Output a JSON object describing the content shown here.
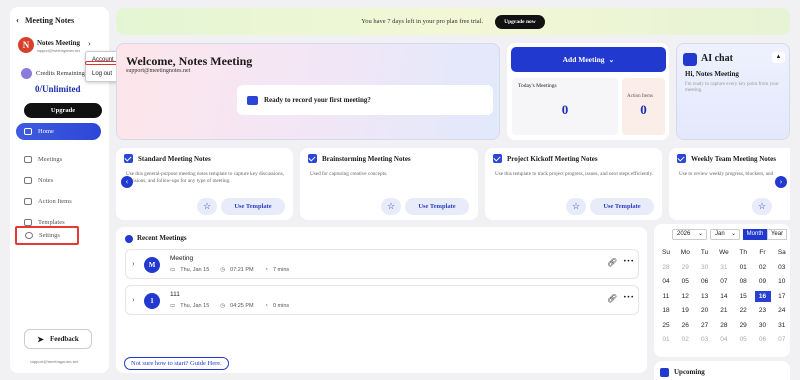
{
  "sidebar": {
    "app_title": "Meeting Notes",
    "back_icon": "chevron-left-icon",
    "user_name": "Notes Meeting",
    "user_email": "support@meetingnotes.net",
    "avatar_letter": "N",
    "credits_label": "Credits Remaining",
    "credits_value": "0/Unlimited",
    "upgrade_label": "Upgrade",
    "nav": [
      {
        "label": "Home",
        "icon": "home-icon"
      },
      {
        "label": "Meetings",
        "icon": "calendar-icon"
      },
      {
        "label": "Notes",
        "icon": "notes-icon"
      },
      {
        "label": "Action Items",
        "icon": "list-icon"
      },
      {
        "label": "Templates",
        "icon": "template-icon"
      },
      {
        "label": "Settings",
        "icon": "gear-icon"
      }
    ],
    "feedback_label": "Feedback",
    "footer_email": "support@meetingnotes.net"
  },
  "account_menu": {
    "account": "Account",
    "logout": "Log out"
  },
  "banner": {
    "text": "You have 7 days left in your pro plan free trial.",
    "button": "Upgrade now"
  },
  "welcome": {
    "title": "Welcome, Notes Meeting",
    "email": "support@meetingnotes.net",
    "cta": "Ready to record your first meeting?"
  },
  "stats": {
    "add_meeting": "Add Meeting",
    "today_label": "Today's Meetings",
    "today_value": "0",
    "action_label": "Action Items",
    "action_value": "0"
  },
  "ai_chat": {
    "title": "AI chat",
    "greeting": "Hi, Notes Meeting",
    "desc": "I'm ready to capture every key point from your meeting."
  },
  "templates": [
    {
      "title": "Standard Meeting Notes",
      "desc": "Use this general-purpose meeting notes template to capture key discussions, decisions, and follow-ups for any type of meeting.",
      "button": "Use Template"
    },
    {
      "title": "Brainstorming Meeting Notes",
      "desc": "Used for capturing creative concepts.",
      "button": "Use Template"
    },
    {
      "title": "Project Kickoff Meeting Notes",
      "desc": "Use this template to track project progress, issues, and next steps efficiently.",
      "button": "Use Template"
    },
    {
      "title": "Weekly Team Meeting Notes",
      "desc": "Use to review weekly progress, blockers, and",
      "button": "Use Template"
    }
  ],
  "recent": {
    "title": "Recent Meetings",
    "items": [
      {
        "letter": "M",
        "name": "Meeting",
        "date": "Thu, Jan 15",
        "time": "07:21 PM",
        "duration": "7 mins"
      },
      {
        "letter": "1",
        "name": "111",
        "date": "Thu, Jan 15",
        "time": "04:25 PM",
        "duration": "0 mins"
      }
    ],
    "guide": "Not sure how to start? Guide Here."
  },
  "calendar": {
    "year": "2026",
    "month": "Jan",
    "view_month": "Month",
    "view_year": "Year",
    "weekdays": [
      "Su",
      "Mo",
      "Tu",
      "We",
      "Th",
      "Fr",
      "Sa"
    ],
    "weeks": [
      [
        "28",
        "29",
        "30",
        "31",
        "01",
        "02",
        "03"
      ],
      [
        "04",
        "05",
        "06",
        "07",
        "08",
        "09",
        "10"
      ],
      [
        "11",
        "12",
        "13",
        "14",
        "15",
        "16",
        "17"
      ],
      [
        "18",
        "19",
        "20",
        "21",
        "22",
        "23",
        "24"
      ],
      [
        "25",
        "26",
        "27",
        "28",
        "29",
        "30",
        "31"
      ],
      [
        "01",
        "02",
        "03",
        "04",
        "05",
        "06",
        "07"
      ]
    ],
    "upcoming": "Upcoming"
  }
}
